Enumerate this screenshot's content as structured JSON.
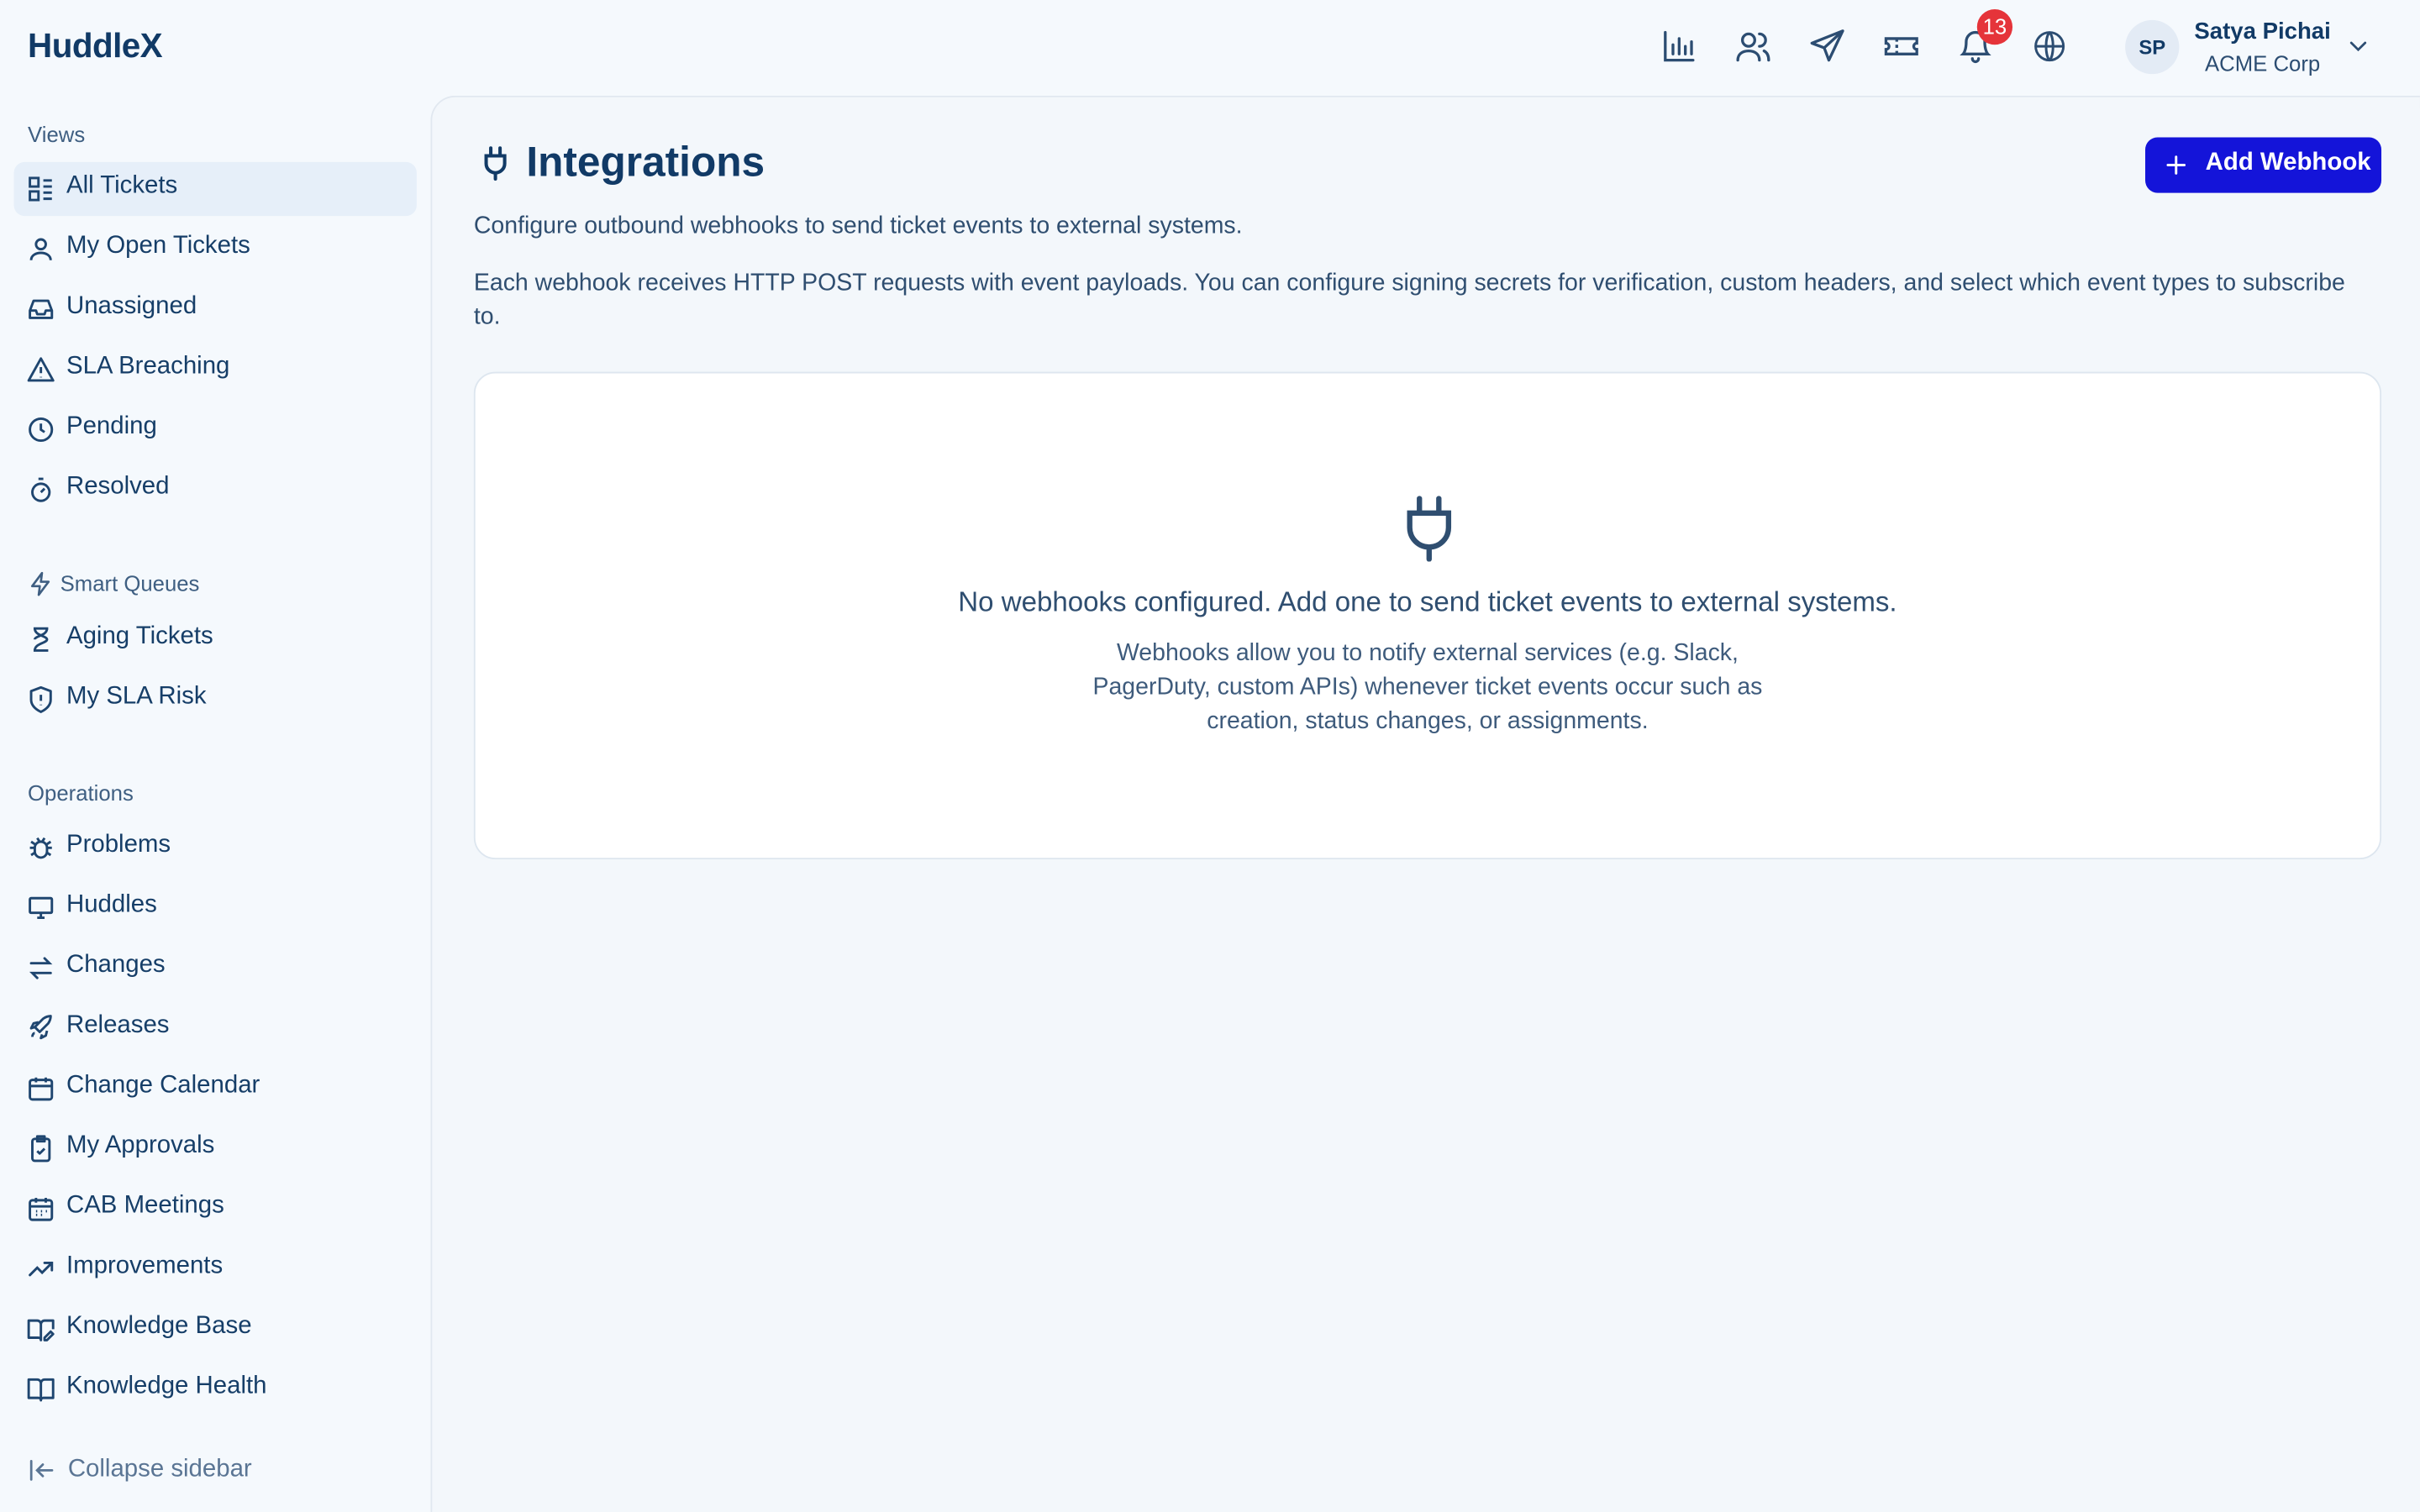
{
  "app": {
    "name": "HuddleX"
  },
  "header": {
    "icons": [
      "bar-chart-icon",
      "users-icon",
      "send-icon",
      "ticket-icon",
      "bell-icon",
      "globe-icon"
    ],
    "notification_count": "13",
    "user": {
      "initials": "SP",
      "name": "Satya Pichai",
      "org": "ACME Corp"
    }
  },
  "sidebar": {
    "views_title": "Views",
    "views": [
      {
        "label": "All Tickets",
        "icon": "list-grid-icon",
        "active": true
      },
      {
        "label": "My Open Tickets",
        "icon": "user-icon"
      },
      {
        "label": "Unassigned",
        "icon": "inbox-icon"
      },
      {
        "label": "SLA Breaching",
        "icon": "warning-icon"
      },
      {
        "label": "Pending",
        "icon": "clock-icon"
      },
      {
        "label": "Resolved",
        "icon": "timer-icon"
      }
    ],
    "smart_title": "Smart Queues",
    "smart": [
      {
        "label": "Aging Tickets",
        "icon": "hourglass-icon"
      },
      {
        "label": "My SLA Risk",
        "icon": "shield-icon"
      }
    ],
    "operations_title": "Operations",
    "operations": [
      {
        "label": "Problems",
        "icon": "bug-icon"
      },
      {
        "label": "Huddles",
        "icon": "monitor-icon"
      },
      {
        "label": "Changes",
        "icon": "arrows-swap-icon"
      },
      {
        "label": "Releases",
        "icon": "rocket-icon"
      },
      {
        "label": "Change Calendar",
        "icon": "calendar-icon"
      },
      {
        "label": "My Approvals",
        "icon": "clipboard-check-icon"
      },
      {
        "label": "CAB Meetings",
        "icon": "calendar-grid-icon"
      },
      {
        "label": "Improvements",
        "icon": "trending-up-icon"
      },
      {
        "label": "Knowledge Base",
        "icon": "book-edit-icon"
      },
      {
        "label": "Knowledge Health",
        "icon": "book-open-icon"
      }
    ],
    "collapse_label": "Collapse sidebar"
  },
  "main": {
    "title": "Integrations",
    "add_button": "Add Webhook",
    "description_1": "Configure outbound webhooks to send ticket events to external systems.",
    "description_2": "Each webhook receives HTTP POST requests with event payloads. You can configure signing secrets for verification, custom headers, and select which event types to subscribe to.",
    "empty": {
      "title": "No webhooks configured. Add one to send ticket events to external systems.",
      "subtitle": "Webhooks allow you to notify external services (e.g. Slack, PagerDuty, custom APIs) whenever ticket events occur such as creation, status changes, or assignments."
    }
  },
  "colors": {
    "accent": "#1414d9",
    "brand": "#113a66",
    "badge": "#e5343a"
  }
}
